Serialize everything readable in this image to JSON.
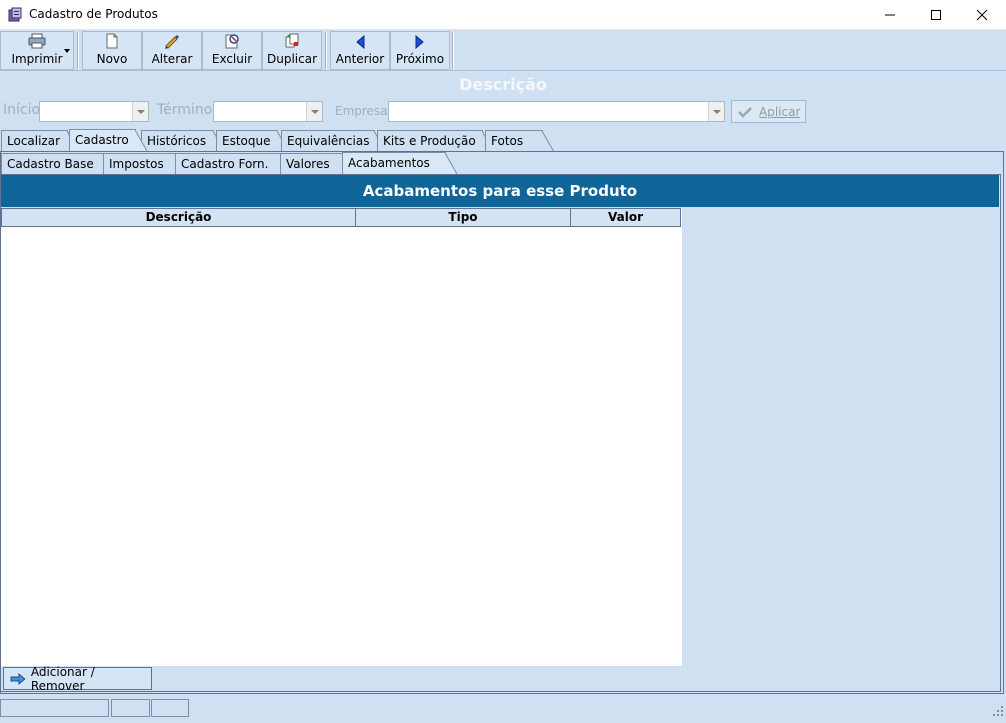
{
  "window": {
    "title": "Cadastro de Produtos",
    "controls": [
      "minimize",
      "maximize",
      "close"
    ]
  },
  "toolbar": {
    "buttons": [
      {
        "label": "Imprimir",
        "icon": "printer-icon"
      },
      {
        "label": "Novo",
        "icon": "new-document-icon"
      },
      {
        "label": "Alterar",
        "icon": "pencil-icon"
      },
      {
        "label": "Excluir",
        "icon": "delete-document-icon"
      },
      {
        "label": "Duplicar",
        "icon": "duplicate-icon"
      },
      {
        "label": "Anterior",
        "icon": "arrow-left-icon"
      },
      {
        "label": "Próximo",
        "icon": "arrow-right-icon"
      }
    ]
  },
  "header": {
    "title": "Descrição"
  },
  "filter": {
    "inicio_label": "Início",
    "termino_label": "Término",
    "empresa_label": "Empresa",
    "inicio_value": "",
    "termino_value": "",
    "empresa_value": "",
    "apply_label": "Aplicar"
  },
  "main_tabs": [
    "Localizar",
    "Cadastro",
    "Históricos",
    "Estoque",
    "Equivalências",
    "Kits e Produção",
    "Fotos"
  ],
  "main_tab_active": "Cadastro",
  "sub_tabs": [
    "Cadastro Base",
    "Impostos",
    "Cadastro Forn.",
    "Valores",
    "Acabamentos"
  ],
  "sub_tab_active": "Acabamentos",
  "section": {
    "title": "Acabamentos para esse Produto",
    "columns": [
      "Descrição",
      "Tipo",
      "Valor"
    ],
    "rows": []
  },
  "actions": {
    "add_remove_label": "Adicionar / Remover"
  },
  "colors": {
    "background": "#cfe0f3",
    "band": "#0f6498",
    "border": "#5f7390"
  }
}
